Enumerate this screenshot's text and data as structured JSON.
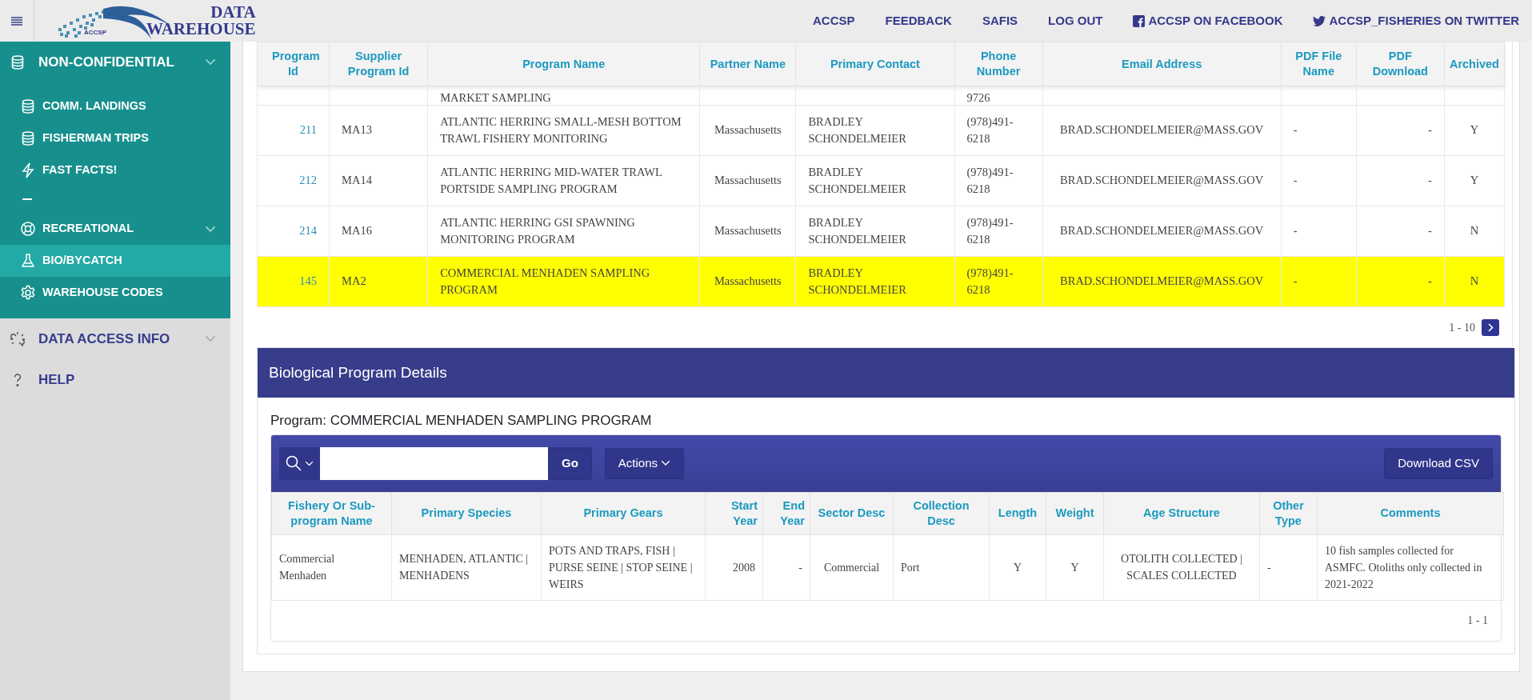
{
  "header": {
    "logo": {
      "title_line1": "DATA",
      "title_line2": "WAREHOUSE",
      "badge": "ACCSP"
    },
    "links": [
      {
        "label": "ACCSP",
        "kind": "text"
      },
      {
        "label": "FEEDBACK",
        "kind": "text"
      },
      {
        "label": "SAFIS",
        "kind": "text"
      },
      {
        "label": "LOG OUT",
        "kind": "text"
      },
      {
        "label": "ACCSP ON FACEBOOK",
        "kind": "facebook"
      },
      {
        "label": "ACCSP_FISHERIES ON TWITTER",
        "kind": "twitter"
      }
    ]
  },
  "sidebar": {
    "items": [
      {
        "label": "NON-CONFIDENTIAL",
        "kind": "database",
        "expanded": true,
        "children": [
          {
            "label": "COMM. LANDINGS",
            "kind": "database",
            "selected": false
          },
          {
            "label": "FISHERMAN TRIPS",
            "kind": "database",
            "selected": false
          },
          {
            "label": "FAST FACTS!",
            "kind": "lightning",
            "selected": false
          },
          {
            "kind": "separator"
          },
          {
            "label": "RECREATIONAL",
            "kind": "lifebuoy",
            "expanded": false,
            "selected": false
          },
          {
            "label": "BIO/BYCATCH",
            "kind": "flask",
            "selected": true
          },
          {
            "label": "WAREHOUSE CODES",
            "kind": "gear",
            "selected": false
          }
        ]
      },
      {
        "label": "DATA ACCESS INFO",
        "kind": "link",
        "expanded": false
      },
      {
        "label": "HELP",
        "kind": "question"
      }
    ]
  },
  "programs_table": {
    "columns": [
      {
        "label": "Program Id",
        "kind": "link"
      },
      {
        "label": "Supplier Program Id",
        "kind": "text"
      },
      {
        "label": "Program Name",
        "kind": "text"
      },
      {
        "label": "Partner Name",
        "kind": "center"
      },
      {
        "label": "Primary Contact",
        "kind": "text"
      },
      {
        "label": "Phone Number",
        "kind": "text"
      },
      {
        "label": "Email Address",
        "kind": "center"
      },
      {
        "label": "PDF File Name",
        "kind": "text"
      },
      {
        "label": "PDF Download",
        "kind": "right"
      },
      {
        "label": "Archived",
        "kind": "center"
      }
    ],
    "rows": [
      {
        "cut_off": true,
        "selected": false,
        "cells": [
          null,
          null,
          "MARKET SAMPLING",
          null,
          null,
          "9726",
          null,
          null,
          null,
          null
        ]
      },
      {
        "cut_off": false,
        "selected": false,
        "cells": [
          "211",
          "MA13",
          "ATLANTIC HERRING SMALL-MESH BOTTOM TRAWL FISHERY MONITORING",
          "Massachusetts",
          "BRADLEY SCHONDELMEIER",
          "(978)491-6218",
          "BRAD.SCHONDELMEIER@MASS.GOV",
          "-",
          "-",
          "Y"
        ]
      },
      {
        "cut_off": false,
        "selected": false,
        "cells": [
          "212",
          "MA14",
          "ATLANTIC HERRING MID-WATER TRAWL PORTSIDE SAMPLING PROGRAM",
          "Massachusetts",
          "BRADLEY SCHONDELMEIER",
          "(978)491-6218",
          "BRAD.SCHONDELMEIER@MASS.GOV",
          "-",
          "-",
          "Y"
        ]
      },
      {
        "cut_off": false,
        "selected": false,
        "cells": [
          "214",
          "MA16",
          "ATLANTIC HERRING GSI SPAWNING MONITORING PROGRAM",
          "Massachusetts",
          "BRADLEY SCHONDELMEIER",
          "(978)491-6218",
          "BRAD.SCHONDELMEIER@MASS.GOV",
          "-",
          "-",
          "N"
        ]
      },
      {
        "cut_off": false,
        "selected": true,
        "cells": [
          "145",
          "MA2",
          "COMMERCIAL MENHADEN SAMPLING PROGRAM",
          "Massachusetts",
          "BRADLEY SCHONDELMEIER",
          "(978)491-6218",
          "BRAD.SCHONDELMEIER@MASS.GOV",
          "-",
          "-",
          "N"
        ]
      }
    ],
    "pagination": "1 - 10"
  },
  "details": {
    "title": "Biological Program Details",
    "program_label": "Program: COMMERCIAL MENHADEN SAMPLING PROGRAM",
    "toolbar": {
      "go_button": "Go",
      "actions_button": "Actions",
      "download_button": "Download CSV"
    },
    "columns": [
      {
        "label": "Fishery Or Sub-program Name",
        "kind": "text"
      },
      {
        "label": "Primary Species",
        "kind": "text"
      },
      {
        "label": "Primary Gears",
        "kind": "text"
      },
      {
        "label": "Start Year",
        "kind": "right"
      },
      {
        "label": "End Year",
        "kind": "right"
      },
      {
        "label": "Sector Desc",
        "kind": "center"
      },
      {
        "label": "Collection Desc",
        "kind": "text"
      },
      {
        "label": "Length",
        "kind": "center"
      },
      {
        "label": "Weight",
        "kind": "center"
      },
      {
        "label": "Age Structure",
        "kind": "center"
      },
      {
        "label": "Other Type",
        "kind": "text"
      },
      {
        "label": "Comments",
        "kind": "text"
      }
    ],
    "rows": [
      [
        "Commercial Menhaden",
        "MENHADEN, ATLANTIC | MENHADENS",
        "POTS AND TRAPS, FISH | PURSE SEINE | STOP SEINE | WEIRS",
        "2008",
        "-",
        "Commercial",
        "Port",
        "Y",
        "Y",
        "OTOLITH COLLECTED | SCALES COLLECTED",
        "-",
        "10 fish samples collected for ASMFC. Otoliths only collected in 2021-2022"
      ]
    ],
    "pagination": "1 - 1"
  }
}
